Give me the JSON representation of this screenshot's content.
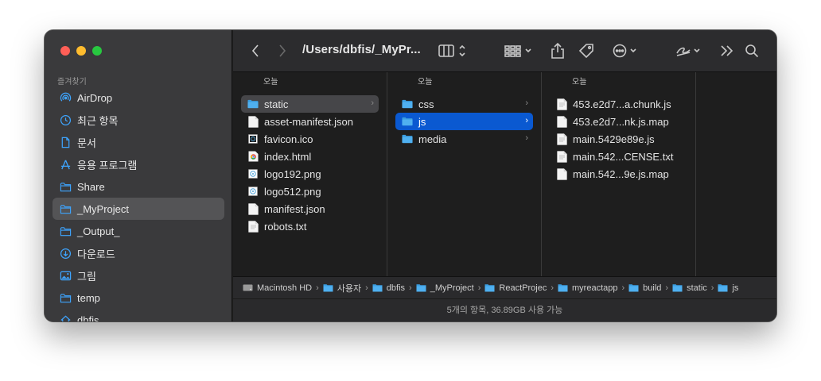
{
  "sidebar": {
    "heading": "즐겨찾기",
    "items": [
      {
        "label": "AirDrop",
        "icon": "airdrop-icon"
      },
      {
        "label": "최근 항목",
        "icon": "clock-icon"
      },
      {
        "label": "문서",
        "icon": "document-icon"
      },
      {
        "label": "응용 프로그램",
        "icon": "applications-icon"
      },
      {
        "label": "Share",
        "icon": "folder-icon"
      },
      {
        "label": "_MyProject",
        "icon": "folder-icon",
        "selected": true
      },
      {
        "label": "_Output_",
        "icon": "folder-icon"
      },
      {
        "label": "다운로드",
        "icon": "download-icon"
      },
      {
        "label": "그림",
        "icon": "photos-icon"
      },
      {
        "label": "temp",
        "icon": "folder-icon"
      },
      {
        "label": "dbfis",
        "icon": "home-icon"
      }
    ]
  },
  "toolbar": {
    "title": "/Users/dbfis/_MyPr..."
  },
  "columns": [
    {
      "heading": "오늘",
      "items": [
        {
          "label": "static",
          "type": "folder",
          "state": "gray",
          "chevron": true
        },
        {
          "label": "asset-manifest.json",
          "type": "file"
        },
        {
          "label": "favicon.ico",
          "type": "ico"
        },
        {
          "label": "index.html",
          "type": "html"
        },
        {
          "label": "logo192.png",
          "type": "image"
        },
        {
          "label": "logo512.png",
          "type": "image"
        },
        {
          "label": "manifest.json",
          "type": "file"
        },
        {
          "label": "robots.txt",
          "type": "text"
        }
      ]
    },
    {
      "heading": "오늘",
      "items": [
        {
          "label": "css",
          "type": "folder",
          "chevron": true
        },
        {
          "label": "js",
          "type": "folder",
          "state": "blue",
          "chevron": true
        },
        {
          "label": "media",
          "type": "folder",
          "chevron": true
        }
      ]
    },
    {
      "heading": "오늘",
      "items": [
        {
          "label": "453.e2d7...a.chunk.js",
          "type": "js"
        },
        {
          "label": "453.e2d7...nk.js.map",
          "type": "file"
        },
        {
          "label": "main.5429e89e.js",
          "type": "js"
        },
        {
          "label": "main.542...CENSE.txt",
          "type": "text"
        },
        {
          "label": "main.542...9e.js.map",
          "type": "file"
        }
      ]
    }
  ],
  "pathbar": [
    {
      "label": "Macintosh HD",
      "icon": "disk-icon"
    },
    {
      "label": "사용자",
      "icon": "folder-icon"
    },
    {
      "label": "dbfis",
      "icon": "folder-icon"
    },
    {
      "label": "_MyProject",
      "icon": "folder-icon"
    },
    {
      "label": "ReactProjec",
      "icon": "folder-icon"
    },
    {
      "label": "myreactapp",
      "icon": "folder-icon"
    },
    {
      "label": "build",
      "icon": "folder-icon"
    },
    {
      "label": "static",
      "icon": "folder-icon"
    },
    {
      "label": "js",
      "icon": "folder-icon"
    }
  ],
  "status": "5개의 항목, 36.89GB 사용 가능",
  "colors": {
    "accent": "#0a59d1",
    "sidebar_icon": "#3ea5ff",
    "folder": "#3a9de0"
  }
}
